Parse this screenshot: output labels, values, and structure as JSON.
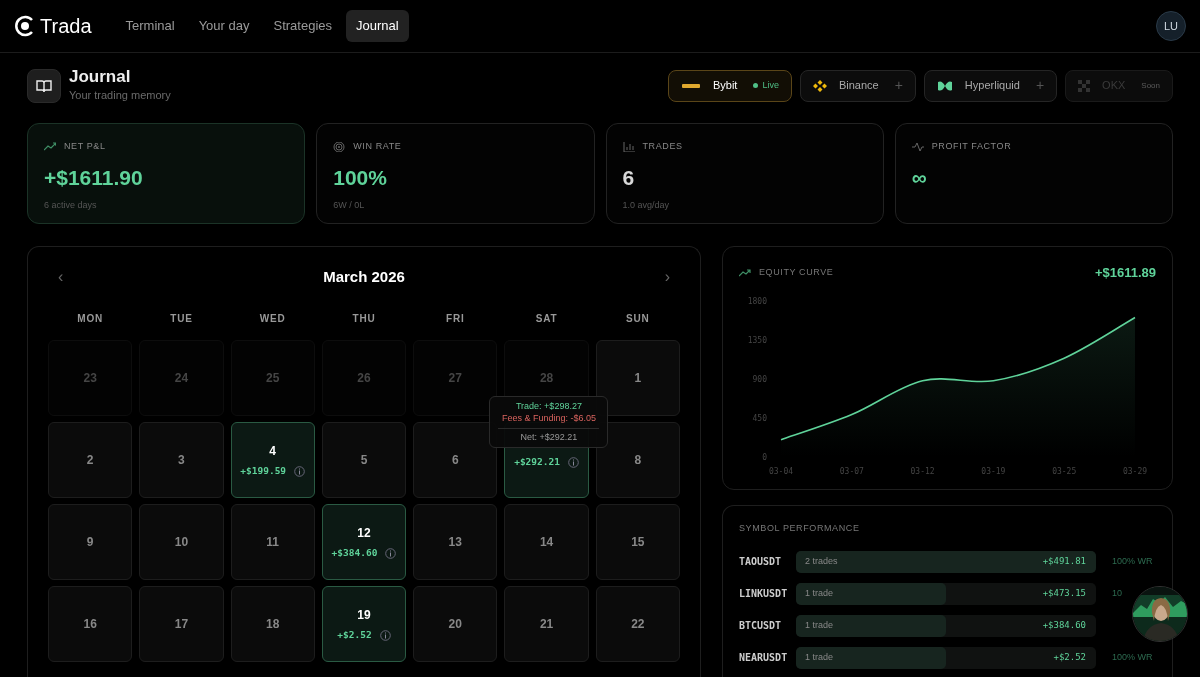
{
  "nav": {
    "brand": "Trada",
    "tabs": [
      {
        "label": "Terminal",
        "selected": false
      },
      {
        "label": "Your day",
        "selected": false
      },
      {
        "label": "Strategies",
        "selected": false
      },
      {
        "label": "Journal",
        "selected": true
      }
    ],
    "avatar": "LU"
  },
  "header": {
    "title": "Journal",
    "subtitle": "Your trading memory"
  },
  "exchanges": [
    {
      "name": "Bybit",
      "kind": "live",
      "status": "Live"
    },
    {
      "name": "Binance",
      "kind": "add",
      "action": "+"
    },
    {
      "name": "Hyperliquid",
      "kind": "add",
      "action": "+"
    },
    {
      "name": "OKX",
      "kind": "soon",
      "status": "Soon"
    }
  ],
  "stats": [
    {
      "label": "NET P&L",
      "value": "+$1611.90",
      "sub": "6 active days",
      "highlighted": true,
      "positive": true
    },
    {
      "label": "WIN RATE",
      "value": "100%",
      "sub": "6W / 0L",
      "highlighted": false,
      "positive": true
    },
    {
      "label": "TRADES",
      "value": "6",
      "sub": "1.0 avg/day",
      "highlighted": false,
      "positive": false
    },
    {
      "label": "PROFIT FACTOR",
      "value": "∞",
      "highlighted": false,
      "positive": true
    }
  ],
  "calendar": {
    "prev": "‹",
    "month": "March 2026",
    "next": "›",
    "weekdays": [
      "MON",
      "TUE",
      "WED",
      "THU",
      "FRI",
      "SAT",
      "SUN"
    ],
    "cells": [
      {
        "day": "23",
        "kind": "outside"
      },
      {
        "day": "24",
        "kind": "outside"
      },
      {
        "day": "25",
        "kind": "outside"
      },
      {
        "day": "26",
        "kind": "outside"
      },
      {
        "day": "27",
        "kind": "outside"
      },
      {
        "day": "28",
        "kind": "outside"
      },
      {
        "day": "1",
        "kind": "day"
      },
      {
        "day": "2",
        "kind": "day"
      },
      {
        "day": "3",
        "kind": "day"
      },
      {
        "day": "4",
        "kind": "profit",
        "pnl": "+$199.59"
      },
      {
        "day": "5",
        "kind": "day"
      },
      {
        "day": "6",
        "kind": "day"
      },
      {
        "kind": "profit",
        "pnl": "+$292.21",
        "tooltip": {
          "trade": "Trade: +$298.27",
          "fees": "Fees & Funding: -$6.05",
          "net": "Net: +$292.21"
        }
      },
      {
        "day": "8",
        "kind": "day"
      },
      {
        "day": "9",
        "kind": "day"
      },
      {
        "day": "10",
        "kind": "day"
      },
      {
        "day": "11",
        "kind": "day"
      },
      {
        "day": "12",
        "kind": "profit",
        "pnl": "+$384.60"
      },
      {
        "day": "13",
        "kind": "day"
      },
      {
        "day": "14",
        "kind": "day"
      },
      {
        "day": "15",
        "kind": "day"
      },
      {
        "day": "16",
        "kind": "day"
      },
      {
        "day": "17",
        "kind": "day"
      },
      {
        "day": "18",
        "kind": "day"
      },
      {
        "day": "19",
        "kind": "profit",
        "pnl": "+$2.52"
      },
      {
        "day": "20",
        "kind": "day"
      },
      {
        "day": "21",
        "kind": "day"
      },
      {
        "day": "22",
        "kind": "day"
      }
    ]
  },
  "equity": {
    "label": "EQUITY CURVE",
    "value": "+$1611.89",
    "chart_data": {
      "type": "area",
      "categories": [
        "03-04",
        "03-07",
        "03-12",
        "03-19",
        "03-25",
        "03-29"
      ],
      "series": [
        {
          "color": "#5fd39a",
          "values": [
            200,
            490,
            880,
            880,
            1140,
            1610
          ]
        }
      ],
      "ylim": [
        0,
        1800
      ],
      "yticks": [
        0,
        450,
        900,
        1350,
        1800
      ]
    }
  },
  "symbols": {
    "title": "SYMBOL PERFORMANCE",
    "rows": [
      {
        "symbol": "TAOUSDT",
        "trades": "2 trades",
        "pnl": "+$491.81",
        "level": 1,
        "wr": "100% WR"
      },
      {
        "symbol": "LINKUSDT",
        "trades": "1 trade",
        "pnl": "+$473.15",
        "level": 0.5,
        "wr": "10"
      },
      {
        "symbol": "BTCUSDT",
        "trades": "1 trade",
        "pnl": "+$384.60",
        "level": 0.5
      },
      {
        "symbol": "NEARUSDT",
        "trades": "1 trade",
        "pnl": "+$2.52",
        "level": 0.5,
        "wr": "100% WR"
      }
    ]
  }
}
